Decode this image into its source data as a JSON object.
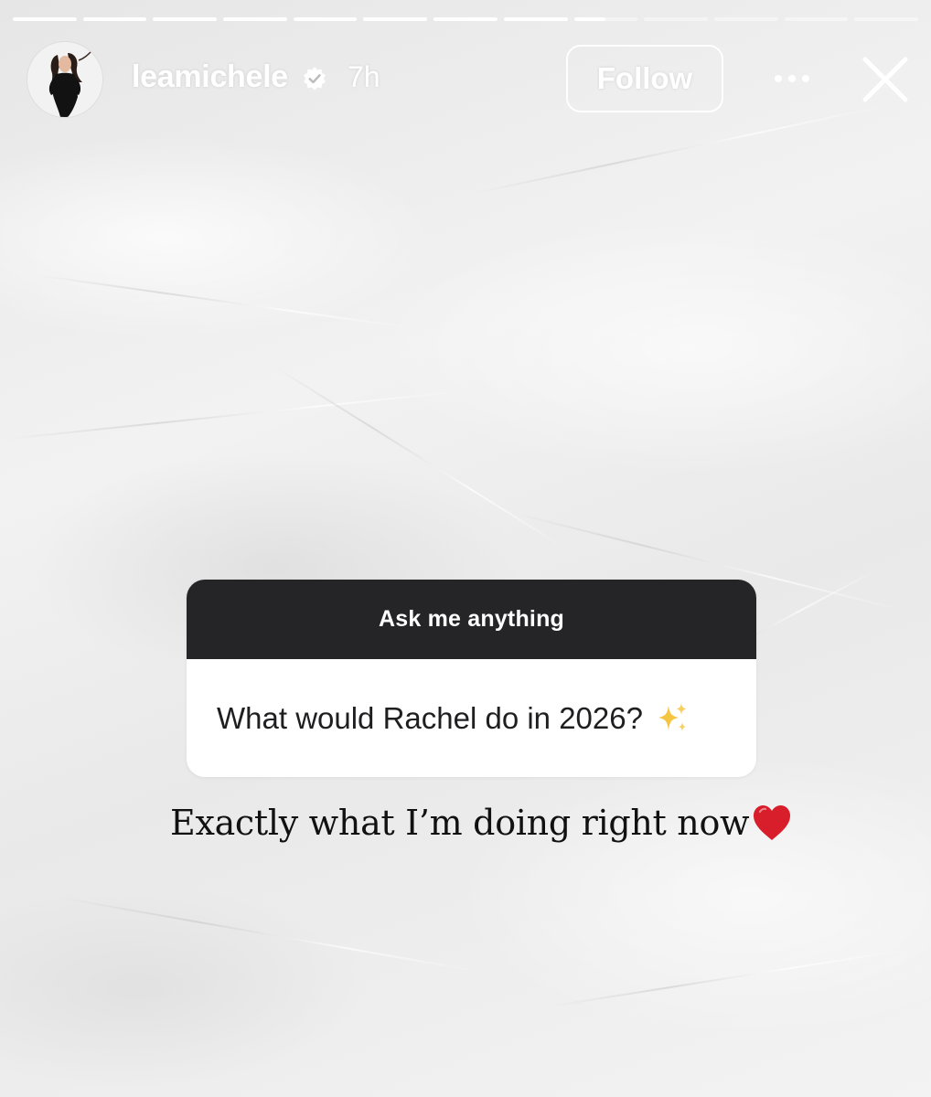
{
  "story": {
    "progress_segments": [
      1,
      1,
      1,
      1,
      1,
      1,
      1,
      1,
      0.5,
      0,
      0,
      0,
      0
    ],
    "user": {
      "username": "leamichele",
      "verified": true,
      "time_ago": "7h",
      "avatar_icon": "profile-avatar"
    },
    "actions": {
      "follow_label": "Follow",
      "more_icon": "more-horizontal-icon",
      "close_icon": "close-icon"
    },
    "question_sticker": {
      "header": "Ask me anything",
      "question": "What would Rachel do in 2026?",
      "question_emoji": "sparkles-icon"
    },
    "answer": {
      "text": "Exactly what I’m doing right now",
      "emoji": "red-heart-icon"
    }
  },
  "colors": {
    "sticker_header_bg": "#252527",
    "heart": "#d81e2a",
    "sparkle": "#f5c542"
  }
}
